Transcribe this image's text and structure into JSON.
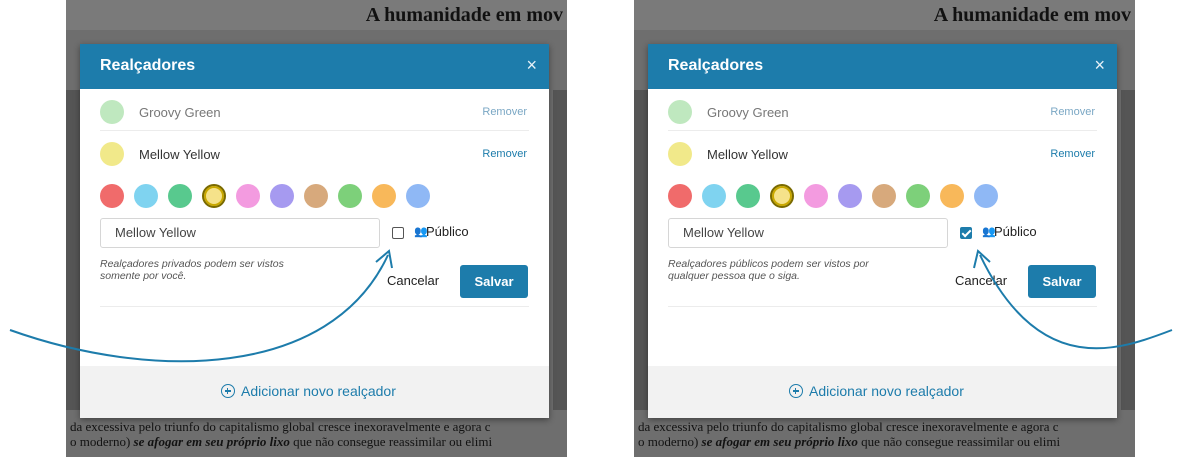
{
  "background": {
    "title": "A humanidade em mov",
    "line1": "da excessiva pelo triunfo do capitalismo global cresce inexoravelmente e agora c",
    "line2_prefix": "o moderno) ",
    "line2_italic": "se afogar em seu próprio lixo",
    "line2_suffix": " que não consegue reassimilar ou elimi"
  },
  "colors": {
    "accent": "#1d7cab",
    "palette": [
      "#f06b6b",
      "#7fd3f0",
      "#58c98e",
      "#f5e28a",
      "#f39be0",
      "#a69af0",
      "#d7a97c",
      "#7dd07a",
      "#f8b85a",
      "#8fb8f5"
    ]
  },
  "panels": [
    {
      "modal": {
        "title": "Realçadores",
        "close": "×",
        "highlighters": [
          {
            "name": "Groovy Green",
            "remove": "Remover",
            "color": "#bfe8bf"
          },
          {
            "name": "Mellow Yellow",
            "remove": "Remover",
            "color": "#f1e98a"
          }
        ],
        "input_value": "Mellow Yellow",
        "public_checked": false,
        "public_label": "Público",
        "help": "Realçadores privados podem ser vistos somente por você.",
        "cancel": "Cancelar",
        "save": "Salvar",
        "add_new": "Adicionar novo realçador"
      }
    },
    {
      "modal": {
        "title": "Realçadores",
        "close": "×",
        "highlighters": [
          {
            "name": "Groovy Green",
            "remove": "Remover",
            "color": "#bfe8bf"
          },
          {
            "name": "Mellow Yellow",
            "remove": "Remover",
            "color": "#f1e98a"
          }
        ],
        "input_value": "Mellow Yellow",
        "public_checked": true,
        "public_label": "Público",
        "help": "Realçadores públicos podem ser vistos por qualquer pessoa que o siga.",
        "cancel": "Cancelar",
        "save": "Salvar",
        "add_new": "Adicionar novo realçador"
      }
    }
  ]
}
